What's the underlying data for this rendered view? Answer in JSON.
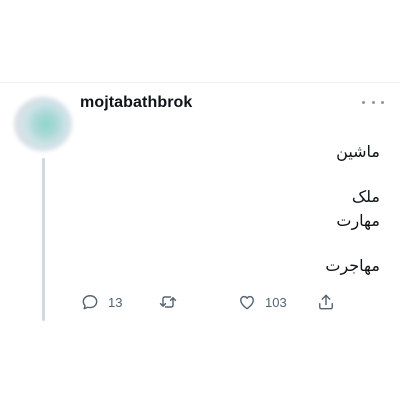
{
  "tweet": {
    "username": "mojtabathbrok",
    "lines": [
      "ماشین",
      "ملک",
      "مهارت",
      "مهاجرت"
    ]
  },
  "actions": {
    "reply_count": "13",
    "like_count": "103"
  },
  "icons": {
    "reply": "speech-bubble-icon",
    "retweet": "retweet-arrows-icon",
    "like": "heart-icon",
    "share": "share-upload-icon",
    "more": "more-dots-icon"
  },
  "colors": {
    "text": "#0f1419",
    "secondary": "#536471",
    "divider": "#eff3f4",
    "thread_line": "#cfd9de"
  }
}
